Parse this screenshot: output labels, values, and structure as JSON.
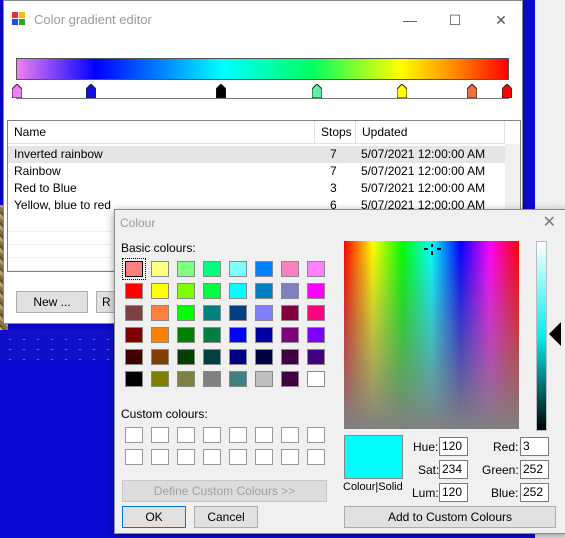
{
  "main_window": {
    "title": "Color gradient editor",
    "minimize": "—",
    "maximize": "☐",
    "close": "✕",
    "gradient_stop_colors": [
      "#f080f0",
      "#1010e0",
      "#000000",
      "#60f0a0",
      "#ffff00",
      "#f07040",
      "#ff0000"
    ],
    "columns": [
      "Name",
      "Stops",
      "Updated"
    ],
    "rows": [
      {
        "name": "Inverted rainbow",
        "stops": "7",
        "updated": "5/07/2021 12:00:00 AM"
      },
      {
        "name": "Rainbow",
        "stops": "7",
        "updated": "5/07/2021 12:00:00 AM"
      },
      {
        "name": "Red to Blue",
        "stops": "3",
        "updated": "5/07/2021 12:00:00 AM"
      },
      {
        "name": "Yellow, blue to red",
        "stops": "6",
        "updated": "5/07/2021 12:00:00 AM"
      }
    ],
    "new_button": "New ...",
    "second_button": "R"
  },
  "colour_dialog": {
    "title": "Colour",
    "close": "✕",
    "basic_label": "Basic colours:",
    "basic_colours": [
      "#ff8080",
      "#ffff80",
      "#80ff80",
      "#00ff80",
      "#80ffff",
      "#0080ff",
      "#ff80c0",
      "#ff80ff",
      "#ff0000",
      "#ffff00",
      "#80ff00",
      "#00ff40",
      "#00ffff",
      "#0080c0",
      "#8080c0",
      "#ff00ff",
      "#804040",
      "#ff8040",
      "#00ff00",
      "#008080",
      "#004080",
      "#8080ff",
      "#800040",
      "#ff0080",
      "#800000",
      "#ff8000",
      "#008000",
      "#008040",
      "#0000ff",
      "#0000a0",
      "#800080",
      "#8000ff",
      "#400000",
      "#804000",
      "#004000",
      "#004040",
      "#000080",
      "#000040",
      "#400040",
      "#400080",
      "#000000",
      "#808000",
      "#808040",
      "#808080",
      "#408080",
      "#c0c0c0",
      "#400040",
      "#ffffff"
    ],
    "custom_label": "Custom colours:",
    "define_button": "Define Custom Colours >>",
    "ok_button": "OK",
    "cancel_button": "Cancel",
    "colour_solid_label": "Colour|Solid",
    "hue_label": "Hue:",
    "hue": "120",
    "sat_label": "Sat:",
    "sat": "234",
    "lum_label": "Lum:",
    "lum": "120",
    "red_label": "Red:",
    "red": "3",
    "green_label": "Green:",
    "green": "252",
    "blue_label": "Blue:",
    "blue": "252",
    "add_button": "Add to Custom Colours",
    "selected_colour": "#03fcfc"
  }
}
